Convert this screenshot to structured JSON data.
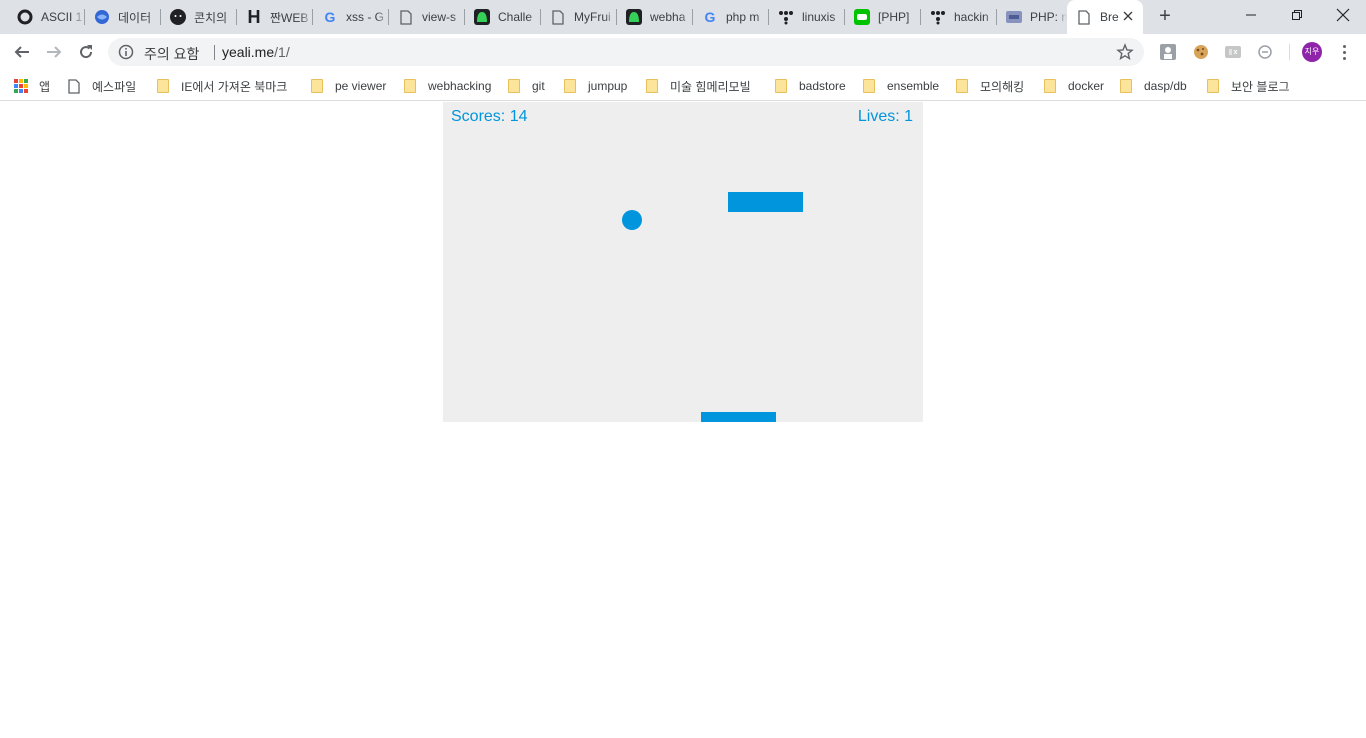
{
  "tabs": [
    {
      "label": "ASCII 1",
      "icon": "circle-logo-icon",
      "active": false
    },
    {
      "label": "데이터",
      "icon": "globe-icon",
      "active": false
    },
    {
      "label": "콘치의",
      "icon": "avatar-face-icon",
      "active": false
    },
    {
      "label": "짠WEB",
      "icon": "h-logo-icon",
      "active": false
    },
    {
      "label": "xss - G",
      "icon": "google-g-icon",
      "active": false
    },
    {
      "label": "view-s",
      "icon": "page-icon",
      "active": false
    },
    {
      "label": "Challe",
      "icon": "green-alien-icon",
      "active": false
    },
    {
      "label": "MyFrui",
      "icon": "page-icon",
      "active": false
    },
    {
      "label": "webha",
      "icon": "green-alien-icon",
      "active": false
    },
    {
      "label": "php m",
      "icon": "google-g-icon",
      "active": false
    },
    {
      "label": "linuxis",
      "icon": "dots-tree-icon",
      "active": false
    },
    {
      "label": "[PHP]",
      "icon": "line-chat-icon",
      "active": false
    },
    {
      "label": "hackin",
      "icon": "dots-tree-icon",
      "active": false
    },
    {
      "label": "PHP: n",
      "icon": "php-logo-icon",
      "active": false
    },
    {
      "label": "Bre",
      "icon": "page-icon",
      "active": true
    }
  ],
  "window": {
    "new_tab_label": "+",
    "minimize_label": "—",
    "close_label": "✕"
  },
  "toolbar": {
    "security_warning": "주의 요함",
    "url_host": "yeali.me",
    "url_path": "/1/",
    "avatar_label": "지우"
  },
  "bookmarks": [
    {
      "label": "앱",
      "icon": "apps-grid-icon"
    },
    {
      "label": "예스파일",
      "icon": "page-icon"
    },
    {
      "label": "IE에서 가져온 북마크",
      "icon": "folder-icon"
    },
    {
      "label": "pe viewer",
      "icon": "folder-icon"
    },
    {
      "label": "webhacking",
      "icon": "folder-icon"
    },
    {
      "label": "git",
      "icon": "folder-icon"
    },
    {
      "label": "jumpup",
      "icon": "folder-icon"
    },
    {
      "label": "미술 힘메리모빌",
      "icon": "folder-icon"
    },
    {
      "label": "badstore",
      "icon": "folder-icon"
    },
    {
      "label": "ensemble",
      "icon": "folder-icon"
    },
    {
      "label": "모의해킹",
      "icon": "folder-icon"
    },
    {
      "label": "docker",
      "icon": "folder-icon"
    },
    {
      "label": "dasp/db",
      "icon": "folder-icon"
    },
    {
      "label": "보안 블로그",
      "icon": "folder-icon"
    }
  ],
  "game": {
    "score_text": "Scores: 14",
    "lives_text": "Lives: 1",
    "colors": {
      "background": "#eeeeee",
      "accent": "#0095dd"
    }
  }
}
